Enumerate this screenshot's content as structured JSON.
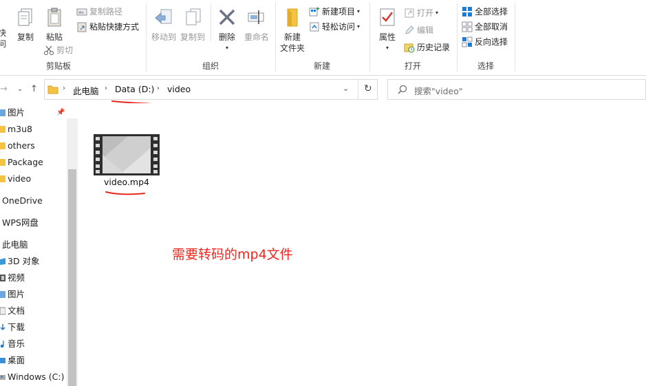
{
  "ribbon": {
    "clipboard": {
      "label": "剪贴板",
      "pin_label_1": "快",
      "pin_label_2": "问",
      "copy": "复制",
      "paste": "粘贴",
      "copy_path": "复制路径",
      "paste_shortcut": "粘贴快捷方式",
      "cut": "剪切"
    },
    "organize": {
      "label": "组织",
      "move_to": "移动到",
      "copy_to": "复制到",
      "delete": "删除",
      "rename": "重命名"
    },
    "new": {
      "label": "新建",
      "new_folder_1": "新建",
      "new_folder_2": "文件夹",
      "new_item": "新建项目",
      "easy_access": "轻松访问"
    },
    "open": {
      "label": "打开",
      "properties": "属性",
      "open": "打开",
      "edit": "编辑",
      "history": "历史记录"
    },
    "select": {
      "label": "选择",
      "select_all": "全部选择",
      "select_none": "全部取消",
      "invert": "反向选择"
    }
  },
  "address": {
    "crumbs": [
      "此电脑",
      "Data (D:)",
      "video"
    ],
    "search_placeholder": "搜索\"video\""
  },
  "nav": {
    "items": [
      "图片",
      "m3u8",
      "others",
      "Package",
      "video",
      "OneDrive",
      "WPS网盘",
      "此电脑",
      "3D 对象",
      "视频",
      "图片",
      "文档",
      "下载",
      "音乐",
      "桌面",
      "Windows (C:)"
    ]
  },
  "content": {
    "file_name": "video.mp4",
    "annotation": "需要转码的mp4文件"
  },
  "colors": {
    "annotation_red": "#f0261e",
    "folder_yellow": "#f5c342",
    "accent_blue": "#1e7ad7"
  }
}
